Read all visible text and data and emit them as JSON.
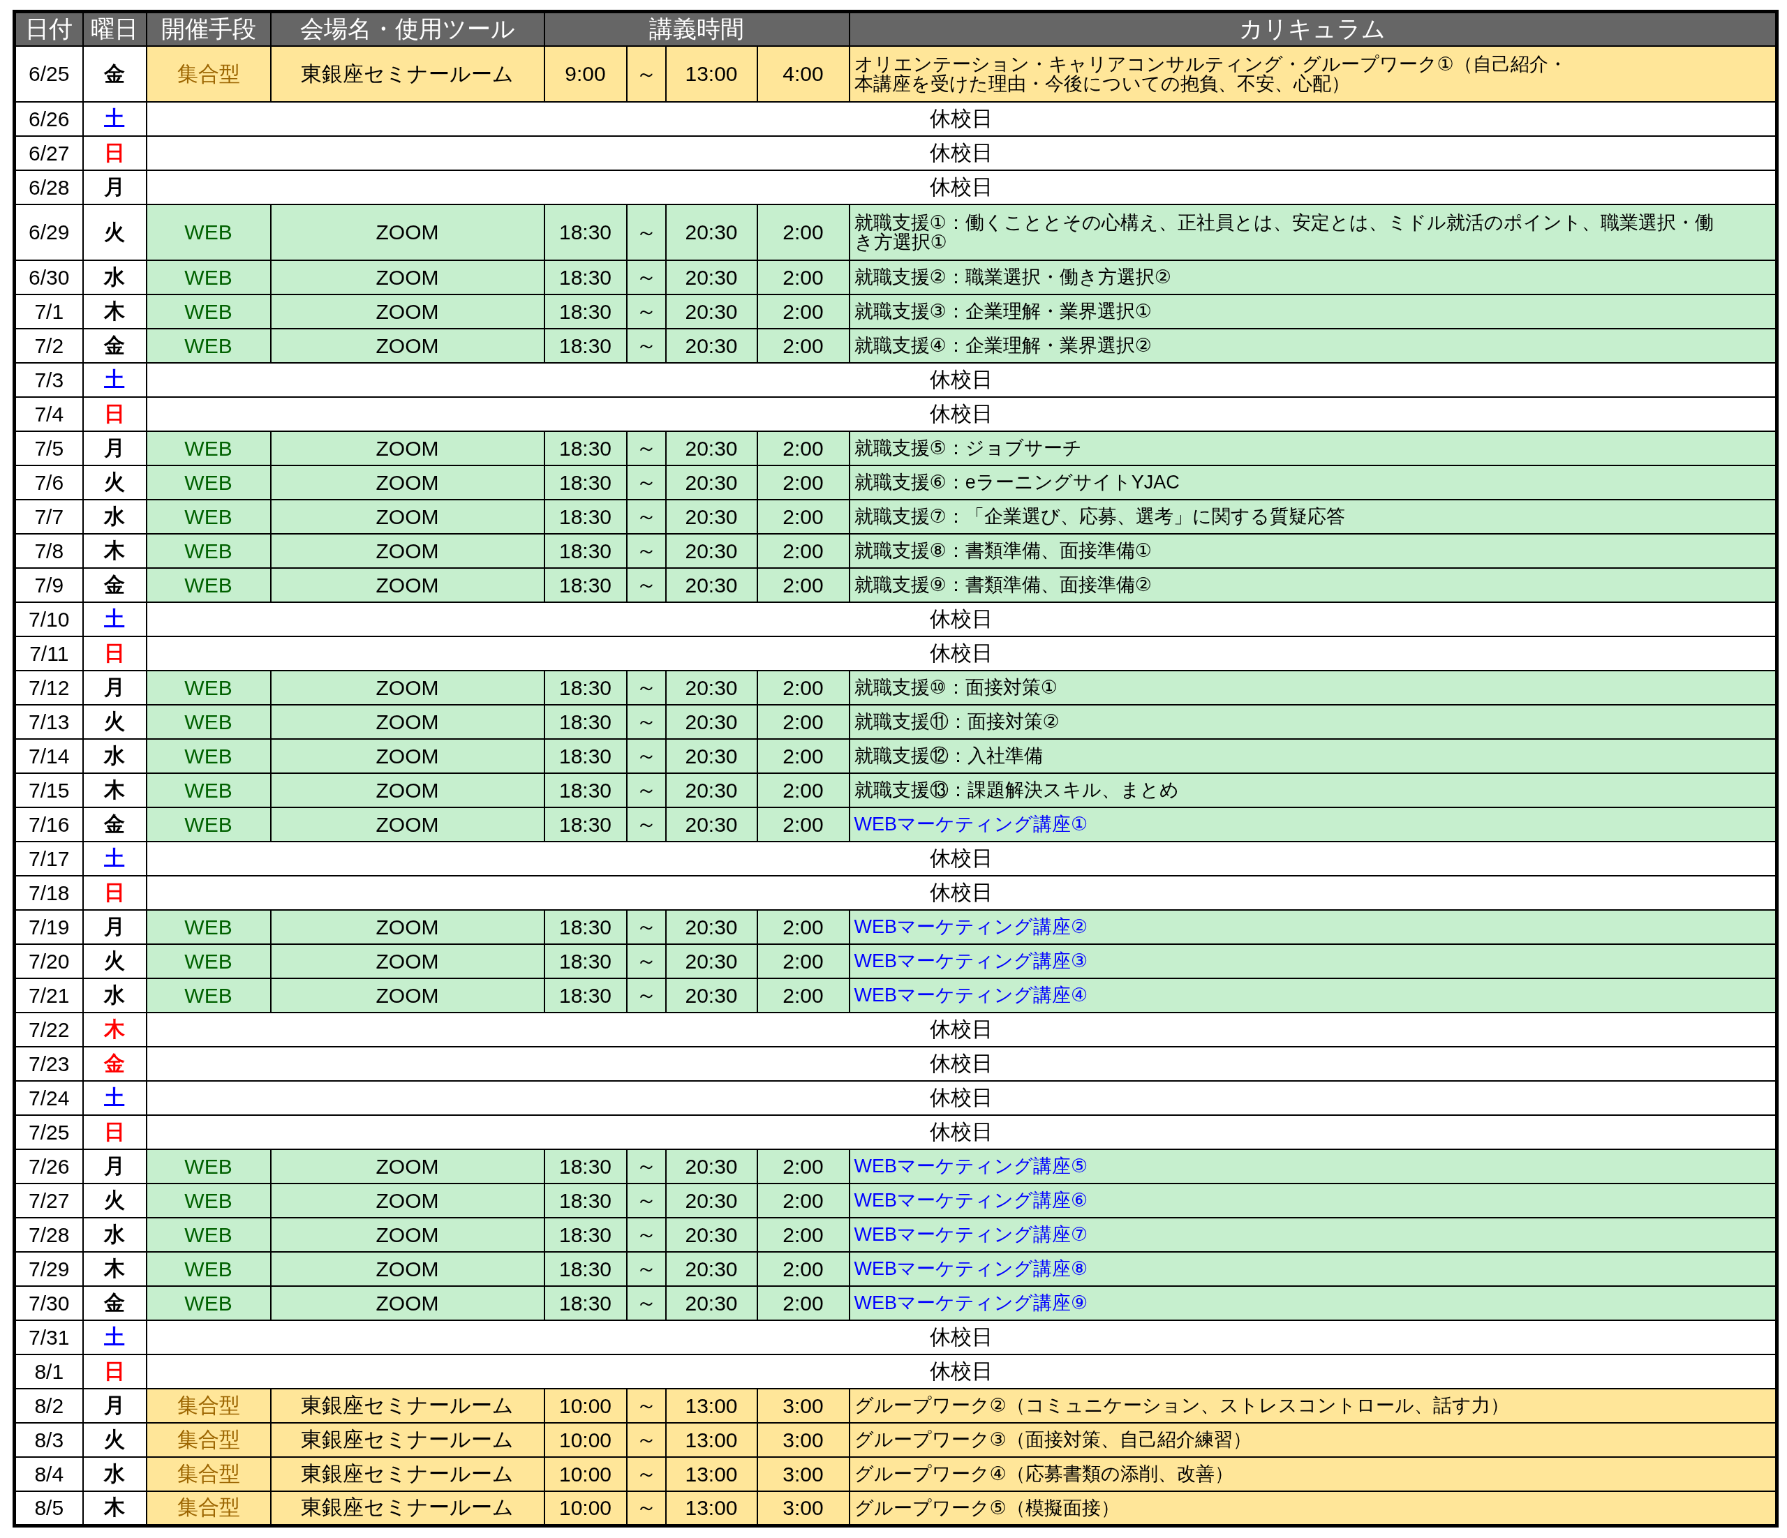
{
  "columns": [
    "日付",
    "曜日",
    "開催手段",
    "会場名・使用ツール",
    "講義時間",
    "カリキュラム"
  ],
  "rows": [
    {
      "date": "6/25",
      "day": {
        "label": "金",
        "kind": "weekday"
      },
      "kind": "in_person",
      "mode": "集合型",
      "venue": "東銀座セミナールーム",
      "start": "9:00",
      "tilde": "～",
      "end": "13:00",
      "duration": "4:00",
      "curriculum": {
        "kind": "general",
        "lines": [
          "オリエンテーション・キャリアコンサルティング・グループワーク①（自己紹介・",
          "本講座を受けた理由・今後についての抱負、不安、心配）"
        ]
      }
    },
    {
      "date": "6/26",
      "day": {
        "label": "土",
        "kind": "saturday"
      },
      "kind": "closed",
      "note": "休校日"
    },
    {
      "date": "6/27",
      "day": {
        "label": "日",
        "kind": "holiday"
      },
      "kind": "closed",
      "note": "休校日"
    },
    {
      "date": "6/28",
      "day": {
        "label": "月",
        "kind": "weekday"
      },
      "kind": "closed",
      "note": "休校日"
    },
    {
      "date": "6/29",
      "day": {
        "label": "火",
        "kind": "weekday"
      },
      "kind": "web",
      "mode": "WEB",
      "venue": "ZOOM",
      "start": "18:30",
      "tilde": "～",
      "end": "20:30",
      "duration": "2:00",
      "curriculum": {
        "kind": "general",
        "lines": [
          "就職支援①：働くこととその心構え、正社員とは、安定とは、ミドル就活のポイント、職業選択・働",
          "き方選択①"
        ]
      }
    },
    {
      "date": "6/30",
      "day": {
        "label": "水",
        "kind": "weekday"
      },
      "kind": "web",
      "mode": "WEB",
      "venue": "ZOOM",
      "start": "18:30",
      "tilde": "～",
      "end": "20:30",
      "duration": "2:00",
      "curriculum": {
        "kind": "general",
        "lines": [
          "就職支援②：職業選択・働き方選択②"
        ]
      }
    },
    {
      "date": "7/1",
      "day": {
        "label": "木",
        "kind": "weekday"
      },
      "kind": "web",
      "mode": "WEB",
      "venue": "ZOOM",
      "start": "18:30",
      "tilde": "～",
      "end": "20:30",
      "duration": "2:00",
      "curriculum": {
        "kind": "general",
        "lines": [
          "就職支援③：企業理解・業界選択①"
        ]
      }
    },
    {
      "date": "7/2",
      "day": {
        "label": "金",
        "kind": "weekday"
      },
      "kind": "web",
      "mode": "WEB",
      "venue": "ZOOM",
      "start": "18:30",
      "tilde": "～",
      "end": "20:30",
      "duration": "2:00",
      "curriculum": {
        "kind": "general",
        "lines": [
          "就職支援④：企業理解・業界選択②"
        ]
      }
    },
    {
      "date": "7/3",
      "day": {
        "label": "土",
        "kind": "saturday"
      },
      "kind": "closed",
      "note": "休校日"
    },
    {
      "date": "7/4",
      "day": {
        "label": "日",
        "kind": "holiday"
      },
      "kind": "closed",
      "note": "休校日"
    },
    {
      "date": "7/5",
      "day": {
        "label": "月",
        "kind": "weekday"
      },
      "kind": "web",
      "mode": "WEB",
      "venue": "ZOOM",
      "start": "18:30",
      "tilde": "～",
      "end": "20:30",
      "duration": "2:00",
      "curriculum": {
        "kind": "general",
        "lines": [
          "就職支援⑤：ジョブサーチ"
        ]
      }
    },
    {
      "date": "7/6",
      "day": {
        "label": "火",
        "kind": "weekday"
      },
      "kind": "web",
      "mode": "WEB",
      "venue": "ZOOM",
      "start": "18:30",
      "tilde": "～",
      "end": "20:30",
      "duration": "2:00",
      "curriculum": {
        "kind": "general",
        "lines": [
          "就職支援⑥：eラーニングサイトYJAC"
        ]
      }
    },
    {
      "date": "7/7",
      "day": {
        "label": "水",
        "kind": "weekday"
      },
      "kind": "web",
      "mode": "WEB",
      "venue": "ZOOM",
      "start": "18:30",
      "tilde": "～",
      "end": "20:30",
      "duration": "2:00",
      "curriculum": {
        "kind": "general",
        "lines": [
          "就職支援⑦：「企業選び、応募、選考」に関する質疑応答"
        ]
      }
    },
    {
      "date": "7/8",
      "day": {
        "label": "木",
        "kind": "weekday"
      },
      "kind": "web",
      "mode": "WEB",
      "venue": "ZOOM",
      "start": "18:30",
      "tilde": "～",
      "end": "20:30",
      "duration": "2:00",
      "curriculum": {
        "kind": "general",
        "lines": [
          "就職支援⑧：書類準備、面接準備①"
        ]
      }
    },
    {
      "date": "7/9",
      "day": {
        "label": "金",
        "kind": "weekday"
      },
      "kind": "web",
      "mode": "WEB",
      "venue": "ZOOM",
      "start": "18:30",
      "tilde": "～",
      "end": "20:30",
      "duration": "2:00",
      "curriculum": {
        "kind": "general",
        "lines": [
          "就職支援⑨：書類準備、面接準備②"
        ]
      }
    },
    {
      "date": "7/10",
      "day": {
        "label": "土",
        "kind": "saturday"
      },
      "kind": "closed",
      "note": "休校日"
    },
    {
      "date": "7/11",
      "day": {
        "label": "日",
        "kind": "holiday"
      },
      "kind": "closed",
      "note": "休校日"
    },
    {
      "date": "7/12",
      "day": {
        "label": "月",
        "kind": "weekday"
      },
      "kind": "web",
      "mode": "WEB",
      "venue": "ZOOM",
      "start": "18:30",
      "tilde": "～",
      "end": "20:30",
      "duration": "2:00",
      "curriculum": {
        "kind": "general",
        "lines": [
          "就職支援⑩：面接対策①"
        ]
      }
    },
    {
      "date": "7/13",
      "day": {
        "label": "火",
        "kind": "weekday"
      },
      "kind": "web",
      "mode": "WEB",
      "venue": "ZOOM",
      "start": "18:30",
      "tilde": "～",
      "end": "20:30",
      "duration": "2:00",
      "curriculum": {
        "kind": "general",
        "lines": [
          "就職支援⑪：面接対策②"
        ]
      }
    },
    {
      "date": "7/14",
      "day": {
        "label": "水",
        "kind": "weekday"
      },
      "kind": "web",
      "mode": "WEB",
      "venue": "ZOOM",
      "start": "18:30",
      "tilde": "～",
      "end": "20:30",
      "duration": "2:00",
      "curriculum": {
        "kind": "general",
        "lines": [
          "就職支援⑫：入社準備"
        ]
      }
    },
    {
      "date": "7/15",
      "day": {
        "label": "木",
        "kind": "weekday"
      },
      "kind": "web",
      "mode": "WEB",
      "venue": "ZOOM",
      "start": "18:30",
      "tilde": "～",
      "end": "20:30",
      "duration": "2:00",
      "curriculum": {
        "kind": "general",
        "lines": [
          "就職支援⑬：課題解決スキル、まとめ"
        ]
      }
    },
    {
      "date": "7/16",
      "day": {
        "label": "金",
        "kind": "weekday"
      },
      "kind": "web",
      "mode": "WEB",
      "venue": "ZOOM",
      "start": "18:30",
      "tilde": "～",
      "end": "20:30",
      "duration": "2:00",
      "curriculum": {
        "kind": "marketing",
        "lines": [
          "WEBマーケティング講座①"
        ]
      }
    },
    {
      "date": "7/17",
      "day": {
        "label": "土",
        "kind": "saturday"
      },
      "kind": "closed",
      "note": "休校日"
    },
    {
      "date": "7/18",
      "day": {
        "label": "日",
        "kind": "holiday"
      },
      "kind": "closed",
      "note": "休校日"
    },
    {
      "date": "7/19",
      "day": {
        "label": "月",
        "kind": "weekday"
      },
      "kind": "web",
      "mode": "WEB",
      "venue": "ZOOM",
      "start": "18:30",
      "tilde": "～",
      "end": "20:30",
      "duration": "2:00",
      "curriculum": {
        "kind": "marketing",
        "lines": [
          "WEBマーケティング講座②"
        ]
      }
    },
    {
      "date": "7/20",
      "day": {
        "label": "火",
        "kind": "weekday"
      },
      "kind": "web",
      "mode": "WEB",
      "venue": "ZOOM",
      "start": "18:30",
      "tilde": "～",
      "end": "20:30",
      "duration": "2:00",
      "curriculum": {
        "kind": "marketing",
        "lines": [
          "WEBマーケティング講座③"
        ]
      }
    },
    {
      "date": "7/21",
      "day": {
        "label": "水",
        "kind": "weekday"
      },
      "kind": "web",
      "mode": "WEB",
      "venue": "ZOOM",
      "start": "18:30",
      "tilde": "～",
      "end": "20:30",
      "duration": "2:00",
      "curriculum": {
        "kind": "marketing",
        "lines": [
          "WEBマーケティング講座④"
        ]
      }
    },
    {
      "date": "7/22",
      "day": {
        "label": "木",
        "kind": "holiday"
      },
      "kind": "closed",
      "note": "休校日"
    },
    {
      "date": "7/23",
      "day": {
        "label": "金",
        "kind": "holiday"
      },
      "kind": "closed",
      "note": "休校日"
    },
    {
      "date": "7/24",
      "day": {
        "label": "土",
        "kind": "saturday"
      },
      "kind": "closed",
      "note": "休校日"
    },
    {
      "date": "7/25",
      "day": {
        "label": "日",
        "kind": "holiday"
      },
      "kind": "closed",
      "note": "休校日"
    },
    {
      "date": "7/26",
      "day": {
        "label": "月",
        "kind": "weekday"
      },
      "kind": "web",
      "mode": "WEB",
      "venue": "ZOOM",
      "start": "18:30",
      "tilde": "～",
      "end": "20:30",
      "duration": "2:00",
      "curriculum": {
        "kind": "marketing",
        "lines": [
          "WEBマーケティング講座⑤"
        ]
      }
    },
    {
      "date": "7/27",
      "day": {
        "label": "火",
        "kind": "weekday"
      },
      "kind": "web",
      "mode": "WEB",
      "venue": "ZOOM",
      "start": "18:30",
      "tilde": "～",
      "end": "20:30",
      "duration": "2:00",
      "curriculum": {
        "kind": "marketing",
        "lines": [
          "WEBマーケティング講座⑥"
        ]
      }
    },
    {
      "date": "7/28",
      "day": {
        "label": "水",
        "kind": "weekday"
      },
      "kind": "web",
      "mode": "WEB",
      "venue": "ZOOM",
      "start": "18:30",
      "tilde": "～",
      "end": "20:30",
      "duration": "2:00",
      "curriculum": {
        "kind": "marketing",
        "lines": [
          "WEBマーケティング講座⑦"
        ]
      }
    },
    {
      "date": "7/29",
      "day": {
        "label": "木",
        "kind": "weekday"
      },
      "kind": "web",
      "mode": "WEB",
      "venue": "ZOOM",
      "start": "18:30",
      "tilde": "～",
      "end": "20:30",
      "duration": "2:00",
      "curriculum": {
        "kind": "marketing",
        "lines": [
          "WEBマーケティング講座⑧"
        ]
      }
    },
    {
      "date": "7/30",
      "day": {
        "label": "金",
        "kind": "weekday"
      },
      "kind": "web",
      "mode": "WEB",
      "venue": "ZOOM",
      "start": "18:30",
      "tilde": "～",
      "end": "20:30",
      "duration": "2:00",
      "curriculum": {
        "kind": "marketing",
        "lines": [
          "WEBマーケティング講座⑨"
        ]
      }
    },
    {
      "date": "7/31",
      "day": {
        "label": "土",
        "kind": "saturday"
      },
      "kind": "closed",
      "note": "休校日"
    },
    {
      "date": "8/1",
      "day": {
        "label": "日",
        "kind": "holiday"
      },
      "kind": "closed",
      "note": "休校日"
    },
    {
      "date": "8/2",
      "day": {
        "label": "月",
        "kind": "weekday"
      },
      "kind": "in_person",
      "mode": "集合型",
      "venue": "東銀座セミナールーム",
      "start": "10:00",
      "tilde": "～",
      "end": "13:00",
      "duration": "3:00",
      "curriculum": {
        "kind": "general",
        "lines": [
          "グループワーク②（コミュニケーション、ストレスコントロール、話す力）"
        ]
      }
    },
    {
      "date": "8/3",
      "day": {
        "label": "火",
        "kind": "weekday"
      },
      "kind": "in_person",
      "mode": "集合型",
      "venue": "東銀座セミナールーム",
      "start": "10:00",
      "tilde": "～",
      "end": "13:00",
      "duration": "3:00",
      "curriculum": {
        "kind": "general",
        "lines": [
          "グループワーク③（面接対策、自己紹介練習）"
        ]
      }
    },
    {
      "date": "8/4",
      "day": {
        "label": "水",
        "kind": "weekday"
      },
      "kind": "in_person",
      "mode": "集合型",
      "venue": "東銀座セミナールーム",
      "start": "10:00",
      "tilde": "～",
      "end": "13:00",
      "duration": "3:00",
      "curriculum": {
        "kind": "general",
        "lines": [
          "グループワーク④（応募書類の添削、改善）"
        ]
      }
    },
    {
      "date": "8/5",
      "day": {
        "label": "木",
        "kind": "weekday"
      },
      "kind": "in_person",
      "mode": "集合型",
      "venue": "東銀座セミナールーム",
      "start": "10:00",
      "tilde": "～",
      "end": "13:00",
      "duration": "3:00",
      "curriculum": {
        "kind": "general",
        "lines": [
          "グループワーク⑤（模擬面接）"
        ]
      }
    }
  ]
}
